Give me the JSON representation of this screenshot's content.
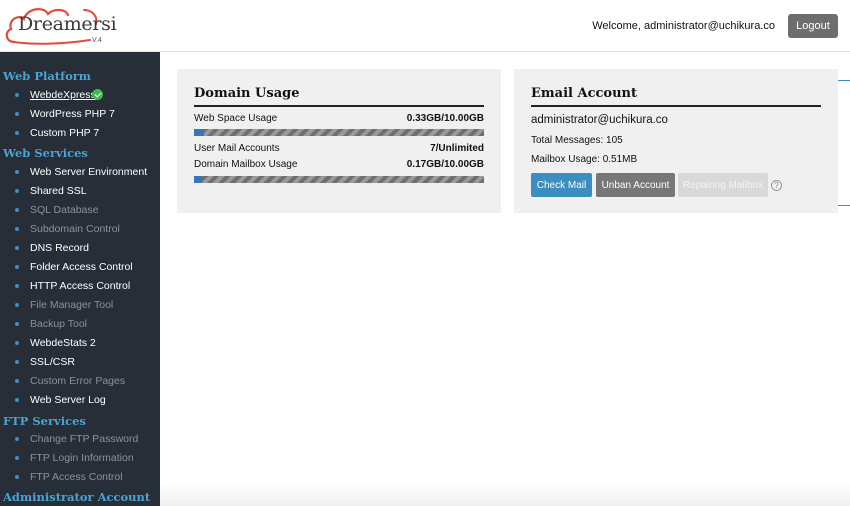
{
  "header": {
    "logo_text": "Dreamersi",
    "logo_version": "V.4",
    "welcome": "Welcome, administrator@uchikura.co",
    "logout_label": "Logout",
    "logo_color": "#e24a3b"
  },
  "sidebar": {
    "sections": [
      {
        "title": "Web Platform"
      },
      {
        "title": "Web Services"
      },
      {
        "title": "FTP Services"
      },
      {
        "title": "Administrator Account"
      }
    ],
    "items": [
      {
        "label": "WebdeXpress",
        "enabled": true,
        "current": true,
        "status_icon": "check-circle-icon"
      },
      {
        "label": "WordPress PHP 7",
        "enabled": true
      },
      {
        "label": "Custom PHP 7",
        "enabled": true
      },
      {
        "label": "Web Server Environment",
        "enabled": true
      },
      {
        "label": "Shared SSL",
        "enabled": true
      },
      {
        "label": "SQL Database",
        "enabled": false
      },
      {
        "label": "Subdomain Control",
        "enabled": false
      },
      {
        "label": "DNS Record",
        "enabled": true
      },
      {
        "label": "Folder Access Control",
        "enabled": true
      },
      {
        "label": "HTTP Access Control",
        "enabled": true
      },
      {
        "label": "File Manager Tool",
        "enabled": false
      },
      {
        "label": "Backup Tool",
        "enabled": false
      },
      {
        "label": "WebdeStats 2",
        "enabled": true
      },
      {
        "label": "SSL/CSR",
        "enabled": true
      },
      {
        "label": "Custom Error Pages",
        "enabled": false
      },
      {
        "label": "Web Server Log",
        "enabled": true
      },
      {
        "label": "Change FTP Password",
        "enabled": false
      },
      {
        "label": "FTP Login Information",
        "enabled": false
      },
      {
        "label": "FTP Access Control",
        "enabled": false
      }
    ]
  },
  "domain_usage": {
    "title": "Domain Usage",
    "web_space_label": "Web Space Usage",
    "web_space_value": "0.33GB/10.00GB",
    "web_space_fraction": 0.033,
    "mail_accounts_label": "User Mail Accounts",
    "mail_accounts_value": "7/Unlimited",
    "mailbox_label": "Domain Mailbox Usage",
    "mailbox_value": "0.17GB/10.00GB",
    "mailbox_fraction": 0.017
  },
  "email_account": {
    "title": "Email Account",
    "address": "administrator@uchikura.co",
    "total_messages": "Total Messages: 105",
    "mailbox_usage": "Mailbox Usage: 0.51MB",
    "check_mail_label": "Check Mail",
    "unban_label": "Unban Account",
    "repair_label": "Repairing Mailbox",
    "help_glyph": "?"
  }
}
